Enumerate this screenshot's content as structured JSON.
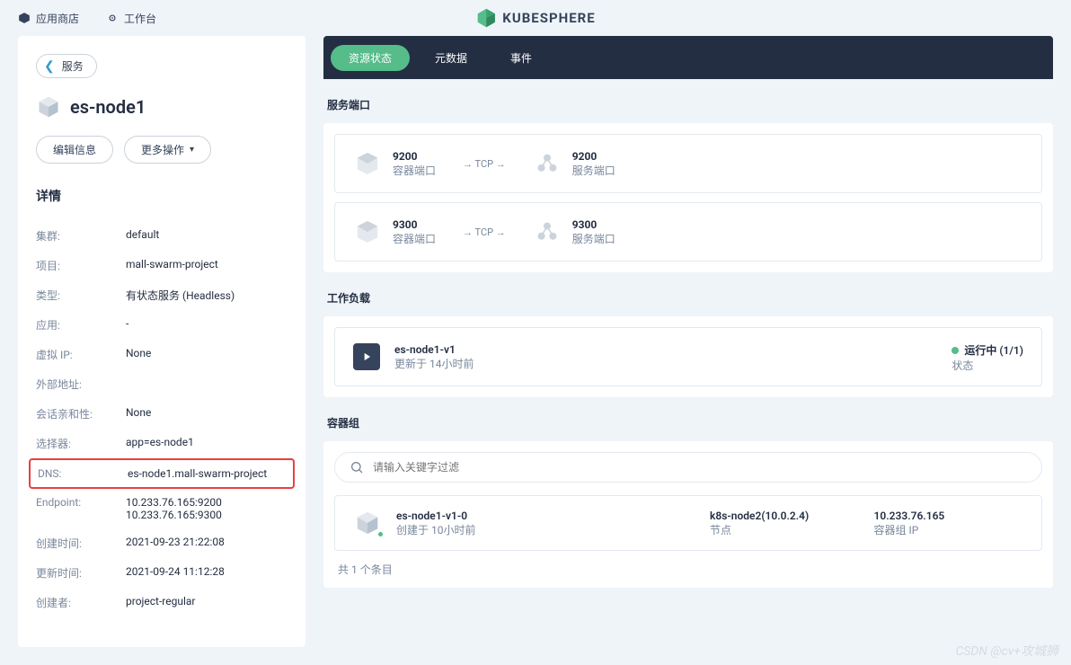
{
  "topnav": {
    "store": "应用商店",
    "workbench": "工作台",
    "brand": "KUBESPHERE"
  },
  "sidebar": {
    "back_label": "服务",
    "title": "es-node1",
    "buttons": {
      "edit": "编辑信息",
      "more": "更多操作"
    },
    "details_title": "详情",
    "details": {
      "cluster_k": "集群:",
      "cluster_v": "default",
      "project_k": "项目:",
      "project_v": "mall-swarm-project",
      "type_k": "类型:",
      "type_v": "有状态服务 (Headless)",
      "app_k": "应用:",
      "app_v": "-",
      "vip_k": "虚拟 IP:",
      "vip_v": "None",
      "ext_k": "外部地址:",
      "ext_v": "",
      "affinity_k": "会话亲和性:",
      "affinity_v": "None",
      "selector_k": "选择器:",
      "selector_v": "app=es-node1",
      "dns_k": "DNS:",
      "dns_v": "es-node1.mall-swarm-project",
      "endpoint_k": "Endpoint:",
      "endpoint_v1": "10.233.76.165:9200",
      "endpoint_v2": "10.233.76.165:9300",
      "created_k": "创建时间:",
      "created_v": "2021-09-23 21:22:08",
      "updated_k": "更新时间:",
      "updated_v": "2021-09-24 11:12:28",
      "creator_k": "创建者:",
      "creator_v": "project-regular"
    }
  },
  "tabs": {
    "status": "资源状态",
    "metadata": "元数据",
    "events": "事件"
  },
  "ports": {
    "section": "服务端口",
    "container_label": "容器端口",
    "service_label": "服务端口",
    "protocol_arrow": "→ TCP →",
    "rows": [
      {
        "container": "9200",
        "service": "9200"
      },
      {
        "container": "9300",
        "service": "9300"
      }
    ]
  },
  "workload": {
    "section": "工作负载",
    "name": "es-node1-v1",
    "updated": "更新于 14小时前",
    "status": "运行中 (1/1)",
    "status_label": "状态"
  },
  "pods": {
    "section": "容器组",
    "search_placeholder": "请输入关键字过滤",
    "name": "es-node1-v1-0",
    "created": "创建于 10小时前",
    "node": "k8s-node2(10.0.2.4)",
    "node_label": "节点",
    "ip": "10.233.76.165",
    "ip_label": "容器组 IP",
    "footer": "共 1 个条目"
  },
  "watermark": "CSDN @cv+攻城狮"
}
